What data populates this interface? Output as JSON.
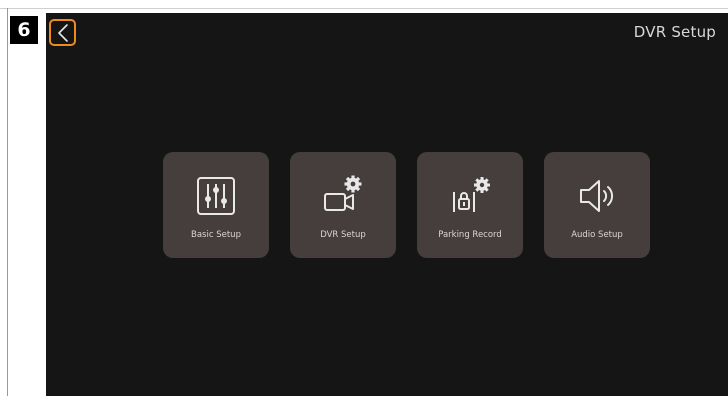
{
  "step_badge": "6",
  "screen": {
    "title": "DVR Setup",
    "back_icon": "chevron-left-icon",
    "accent_color": "#f08a1c",
    "tiles": [
      {
        "label": "Basic Setup",
        "icon": "sliders-icon"
      },
      {
        "label": "DVR Setup",
        "icon": "camera-gear-icon"
      },
      {
        "label": "Parking Record",
        "icon": "parking-gear-icon"
      },
      {
        "label": "Audio Setup",
        "icon": "speaker-icon"
      }
    ]
  }
}
